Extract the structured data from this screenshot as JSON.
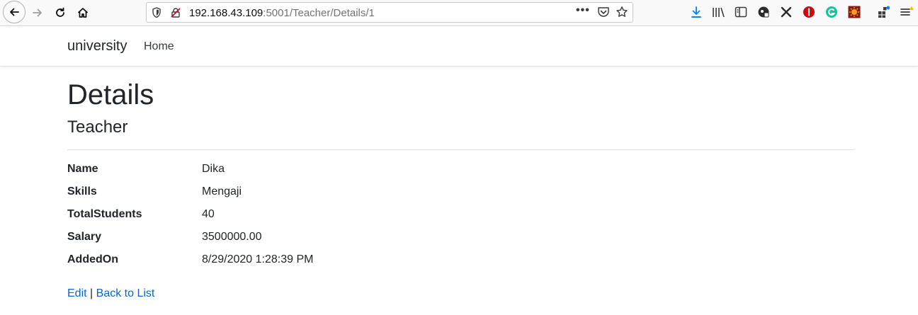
{
  "browser": {
    "url_host": "192.168.43.109",
    "url_rest": ":5001/Teacher/Details/1",
    "more_label": "•••",
    "icons": [
      "back-icon",
      "forward-icon",
      "reload-icon",
      "home-icon",
      "shield-icon",
      "insecure-lock-icon",
      "page-actions-icon",
      "pocket-icon",
      "bookmark-star-icon",
      "download-icon",
      "library-icon",
      "sidebar-icon",
      "extension-icons",
      "menu-icon"
    ]
  },
  "navbar": {
    "brand": "university",
    "links": [
      "Home"
    ]
  },
  "page": {
    "title": "Details",
    "subtitle": "Teacher"
  },
  "details": [
    {
      "label": "Name",
      "value": "Dika"
    },
    {
      "label": "Skills",
      "value": "Mengaji"
    },
    {
      "label": "TotalStudents",
      "value": "40"
    },
    {
      "label": "Salary",
      "value": "3500000.00"
    },
    {
      "label": "AddedOn",
      "value": "8/29/2020 1:28:39 PM"
    }
  ],
  "actions": {
    "edit": "Edit",
    "separator": "|",
    "back": "Back to List"
  },
  "colors": {
    "link": "#0366d6",
    "text": "#212529",
    "toolbar_bg": "#f9f9fa"
  }
}
